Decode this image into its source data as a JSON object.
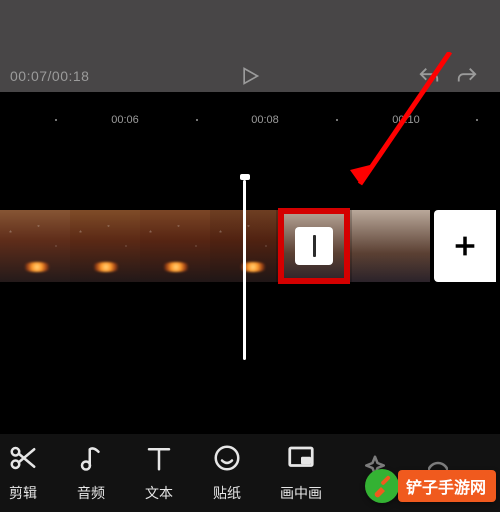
{
  "time": {
    "current": "00:07",
    "total": "00:18",
    "combined": "00:07/00:18"
  },
  "ruler": {
    "t1": "00:06",
    "t2": "00:08",
    "t3": "00:10"
  },
  "tools": {
    "cut": {
      "label": "剪辑",
      "icon": "scissors-icon"
    },
    "audio": {
      "label": "音频",
      "icon": "music-note-icon"
    },
    "text": {
      "label": "文本",
      "icon": "text-icon"
    },
    "sticker": {
      "label": "贴纸",
      "icon": "sticker-icon"
    },
    "pip": {
      "label": "画中画",
      "icon": "pip-icon"
    },
    "effects": {
      "label": "",
      "icon": "sparkle-icon"
    }
  },
  "icons": {
    "play": "play-icon",
    "undo": "undo-icon",
    "redo": "redo-icon",
    "add": "plus-icon",
    "transition": "transition-icon"
  },
  "annotation": {
    "arrow_color": "#ff0000",
    "highlight_color": "#d40000"
  },
  "watermark": {
    "text": "铲子手游网",
    "brand_green": "#34b233",
    "brand_orange": "#f05a1e"
  }
}
